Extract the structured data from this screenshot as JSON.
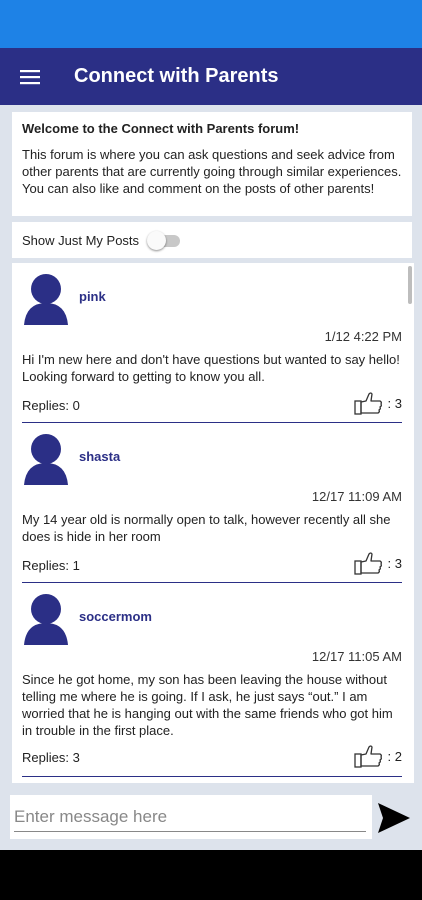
{
  "header": {
    "title": "Connect with Parents",
    "menu_icon": "hamburger-menu-icon"
  },
  "intro": {
    "title": "Welcome to the Connect with Parents forum!",
    "body": "This forum is where you can ask questions and seek advice from other parents that are currently going through similar experiences. You can also like and comment on the posts of other parents!"
  },
  "filter": {
    "label": "Show Just My Posts",
    "enabled": false
  },
  "posts": [
    {
      "username": "pink",
      "timestamp": "1/12 4:22 PM",
      "body": "Hi I'm new here and don't have questions but wanted to say hello! Looking forward to getting to know you all.",
      "replies": "Replies: 0",
      "likes": ": 3"
    },
    {
      "username": "shasta",
      "timestamp": "12/17 11:09 AM",
      "body": "My 14 year old is normally open to talk, however recently all she does is hide in her room",
      "replies": "Replies: 1",
      "likes": ": 3"
    },
    {
      "username": "soccermom",
      "timestamp": "12/17 11:05 AM",
      "body": "Since he got home, my son has been leaving the house without telling me where he is going. If I ask, he just says “out.” I am worried that he is hanging out with the same friends who got him in trouble in the first place.",
      "replies": "Replies: 3",
      "likes": ": 2"
    }
  ],
  "composer": {
    "placeholder": "Enter message here",
    "value": "",
    "send_icon": "send-icon"
  },
  "colors": {
    "status_bar": "#1e82e6",
    "app_bar": "#2b2f86",
    "accent": "#2b2f86",
    "background": "#dde3ec"
  }
}
